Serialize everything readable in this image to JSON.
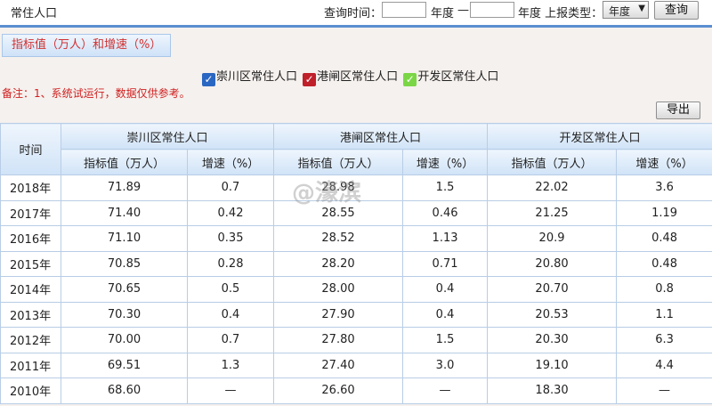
{
  "header": {
    "title": "常住人口",
    "query_time_label": "查询时间：",
    "start_year": "",
    "unit_label": "年度",
    "dash": "—",
    "end_year": "",
    "report_type_label": "年度 上报类型：",
    "report_type_value": "年度",
    "query_button": "查询"
  },
  "metric_box": {
    "label": "指标值（万人）和增速（%）"
  },
  "legend": [
    {
      "label": "崇川区常住人口",
      "color": "#2a67c2"
    },
    {
      "label": "港闸区常住人口",
      "color": "#c0202a"
    },
    {
      "label": "开发区常住人口",
      "color": "#7bd646"
    }
  ],
  "note": "备注：1、系统试运行，数据仅供参考。",
  "export_button": "导出",
  "watermark": "@濠滨",
  "table": {
    "time_header": "时间",
    "groups": [
      "崇川区常住人口",
      "港闸区常住人口",
      "开发区常住人口"
    ],
    "sub_headers": [
      "指标值（万人）",
      "增速（%）",
      "指标值（万人）",
      "增速（%）",
      "指标值（万人）",
      "增速（%）"
    ],
    "rows": [
      [
        "2018年",
        "71.89",
        "0.7",
        "28.98",
        "1.5",
        "22.02",
        "3.6"
      ],
      [
        "2017年",
        "71.40",
        "0.42",
        "28.55",
        "0.46",
        "21.25",
        "1.19"
      ],
      [
        "2016年",
        "71.10",
        "0.35",
        "28.52",
        "1.13",
        "20.9",
        "0.48"
      ],
      [
        "2015年",
        "70.85",
        "0.28",
        "28.20",
        "0.71",
        "20.80",
        "0.48"
      ],
      [
        "2014年",
        "70.65",
        "0.5",
        "28.00",
        "0.4",
        "20.70",
        "0.8"
      ],
      [
        "2013年",
        "70.30",
        "0.4",
        "27.90",
        "0.4",
        "20.53",
        "1.1"
      ],
      [
        "2012年",
        "70.00",
        "0.7",
        "27.80",
        "1.5",
        "20.30",
        "6.3"
      ],
      [
        "2011年",
        "69.51",
        "1.3",
        "27.40",
        "3.0",
        "19.10",
        "4.4"
      ],
      [
        "2010年",
        "68.60",
        "—",
        "26.60",
        "—",
        "18.30",
        "—"
      ]
    ]
  }
}
